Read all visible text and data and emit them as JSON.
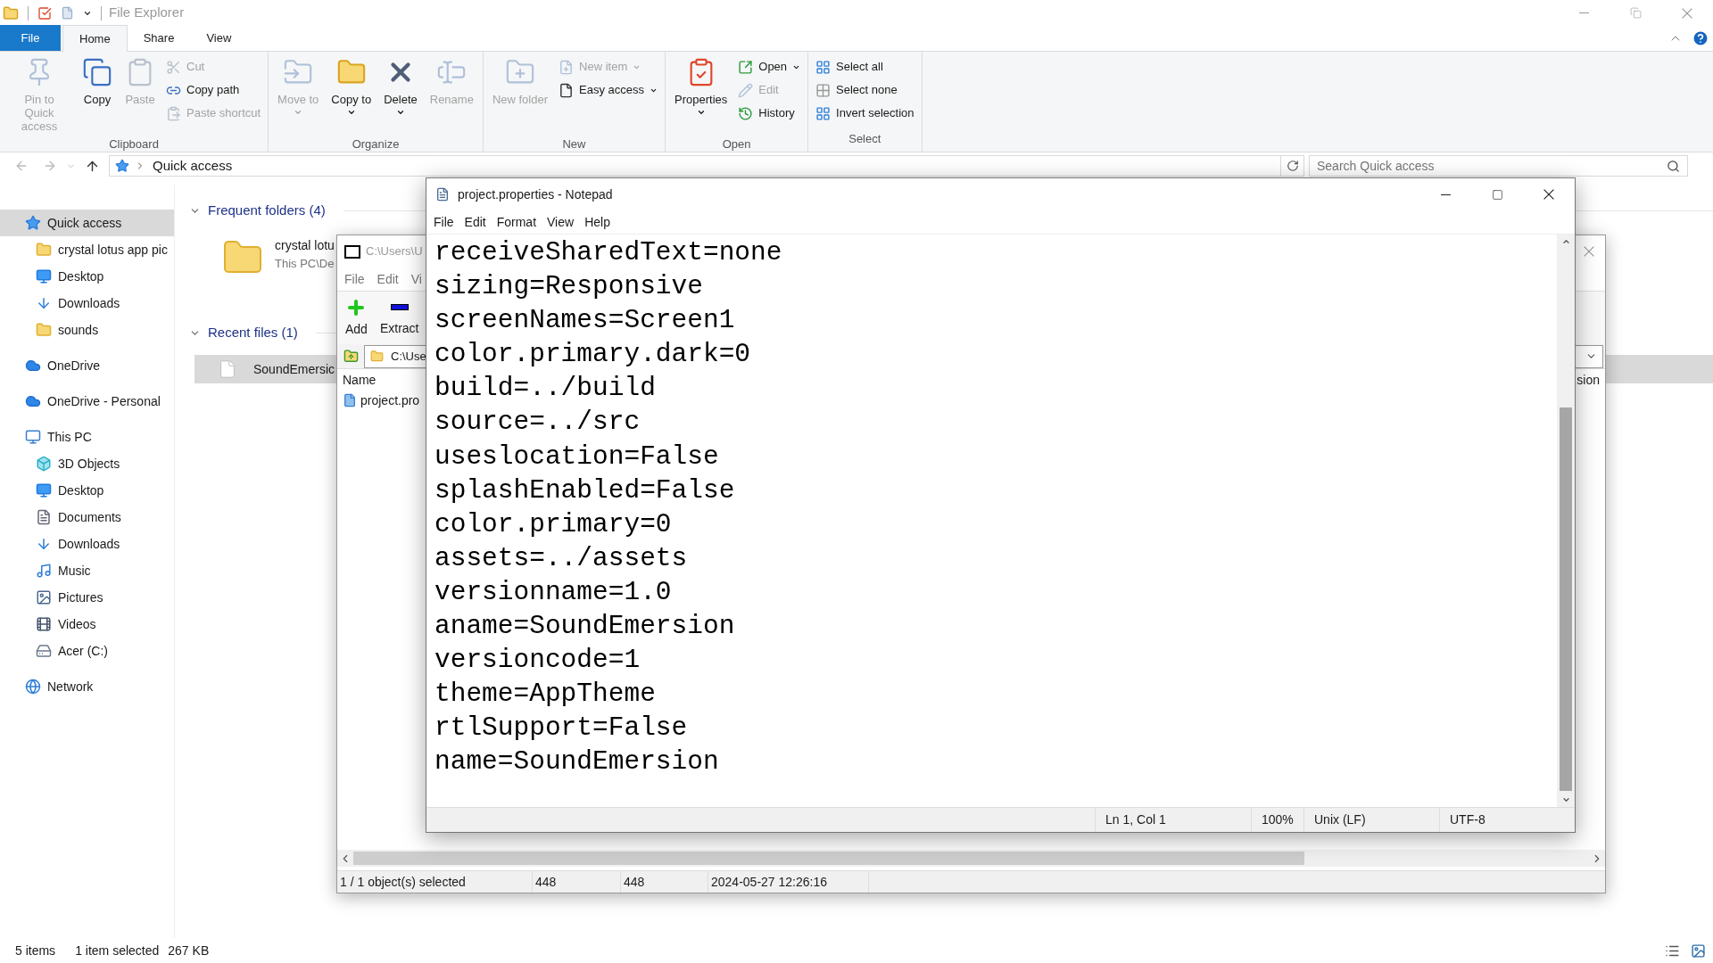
{
  "explorer": {
    "title": "File Explorer",
    "tabs": [
      {
        "label": "File",
        "kind": "menu",
        "selected": false
      },
      {
        "label": "Home",
        "kind": "tab",
        "selected": true
      },
      {
        "label": "Share",
        "kind": "tab",
        "selected": false
      },
      {
        "label": "View",
        "kind": "tab",
        "selected": false
      }
    ],
    "ribbon": [
      {
        "label": "Clipboard",
        "items": [
          {
            "label": "Pin to Quick access",
            "kind": "pin",
            "disabled": true,
            "dropdown": false
          },
          {
            "label": "Copy",
            "kind": "copy",
            "disabled": false,
            "dropdown": false
          },
          {
            "label": "Paste",
            "kind": "paste",
            "disabled": true,
            "dropdown": false
          },
          {
            "label": "Cut",
            "kind": "cut",
            "disabled": true,
            "dropdown": false
          },
          {
            "label": "Copy path",
            "kind": "copy-path",
            "disabled": false,
            "dropdown": false
          },
          {
            "label": "Paste shortcut",
            "kind": "paste-shortcut",
            "disabled": true,
            "dropdown": false
          }
        ]
      },
      {
        "label": "Organize",
        "items": [
          {
            "label": "Move to",
            "kind": "move",
            "disabled": true,
            "dropdown": true
          },
          {
            "label": "Copy to",
            "kind": "copy-to",
            "disabled": false,
            "dropdown": true
          },
          {
            "label": "Delete",
            "kind": "delete",
            "disabled": false,
            "dropdown": true
          },
          {
            "label": "Rename",
            "kind": "rename",
            "disabled": true,
            "dropdown": false
          }
        ]
      },
      {
        "label": "New",
        "items": [
          {
            "label": "New folder",
            "kind": "new-folder",
            "disabled": true,
            "dropdown": false
          },
          {
            "label": "New item",
            "kind": "new-item",
            "disabled": true,
            "dropdown": true
          },
          {
            "label": "Easy access",
            "kind": "easy-access",
            "disabled": false,
            "dropdown": true
          }
        ]
      },
      {
        "label": "Open",
        "items": [
          {
            "label": "Properties",
            "kind": "properties",
            "disabled": false,
            "dropdown": true
          },
          {
            "label": "Open",
            "kind": "open",
            "disabled": false,
            "dropdown": true
          },
          {
            "label": "Edit",
            "kind": "edit",
            "disabled": true,
            "dropdown": false
          },
          {
            "label": "History",
            "kind": "history",
            "disabled": false,
            "dropdown": false
          }
        ]
      },
      {
        "label": "Select",
        "items": [
          {
            "label": "Select all",
            "kind": "select-all",
            "disabled": false,
            "dropdown": false
          },
          {
            "label": "Select none",
            "kind": "select-none",
            "disabled": false,
            "dropdown": false
          },
          {
            "label": "Invert selection",
            "kind": "invert",
            "disabled": false,
            "dropdown": false
          }
        ]
      }
    ],
    "address": {
      "path": "Quick access"
    },
    "search": {
      "placeholder": "Search Quick access"
    },
    "nav": [
      {
        "label": "Quick access",
        "kind": "quick-access",
        "selected": true,
        "children": [
          {
            "label": "crystal lotus app pic",
            "kind": "folder",
            "selected": false
          },
          {
            "label": "Desktop",
            "kind": "desktop",
            "selected": false
          },
          {
            "label": "Downloads",
            "kind": "downloads",
            "selected": false
          },
          {
            "label": "sounds",
            "kind": "folder",
            "selected": false
          }
        ]
      },
      {
        "label": "OneDrive",
        "kind": "cloud",
        "selected": false
      },
      {
        "label": "OneDrive - Personal",
        "kind": "cloud",
        "selected": false
      },
      {
        "label": "This PC",
        "kind": "pc",
        "selected": false,
        "children": [
          {
            "label": "3D Objects",
            "kind": "objects3d",
            "selected": false
          },
          {
            "label": "Desktop",
            "kind": "desktop",
            "selected": false
          },
          {
            "label": "Documents",
            "kind": "documents",
            "selected": false
          },
          {
            "label": "Downloads",
            "kind": "downloads",
            "selected": false
          },
          {
            "label": "Music",
            "kind": "music",
            "selected": false
          },
          {
            "label": "Pictures",
            "kind": "pictures",
            "selected": false
          },
          {
            "label": "Videos",
            "kind": "videos",
            "selected": false
          },
          {
            "label": "Acer (C:)",
            "kind": "drive",
            "selected": false
          }
        ]
      },
      {
        "label": "Network",
        "kind": "network",
        "selected": false
      }
    ],
    "frequent": {
      "heading": "Frequent folders (4)",
      "items": [
        {
          "name": "crystal lotu",
          "location": "This PC\\De"
        }
      ]
    },
    "recent": {
      "heading": "Recent files (1)",
      "items": [
        {
          "name": "SoundEmersic",
          "selected": true
        }
      ]
    },
    "status": [
      "5 items",
      "1 item selected",
      "267 KB"
    ]
  },
  "archive_window": {
    "title": "C:\\Users\\U",
    "menu": [
      "File",
      "Edit",
      "Vi"
    ],
    "toolbar": [
      {
        "label": "Add",
        "kind": "add"
      },
      {
        "label": "Extract",
        "kind": "extract"
      }
    ],
    "path": "C:\\Use",
    "columns": [
      "Name",
      "sion"
    ],
    "files": [
      {
        "name": "project.pro"
      }
    ],
    "status": [
      "1 / 1 object(s) selected",
      "448",
      "448",
      "2024-05-27 12:26:16"
    ]
  },
  "notepad": {
    "title": "project.properties - Notepad",
    "menu": [
      "File",
      "Edit",
      "Format",
      "View",
      "Help"
    ],
    "lines": [
      "receiveSharedText=none",
      "sizing=Responsive",
      "screenNames=Screen1",
      "color.primary.dark=0",
      "build=../build",
      "source=../src",
      "useslocation=False",
      "splashEnabled=False",
      "color.primary=0",
      "assets=../assets",
      "versionname=1.0",
      "aname=SoundEmersion",
      "versioncode=1",
      "theme=AppTheme",
      "rtlSupport=False",
      "name=SoundEmersion"
    ],
    "status": [
      "Ln 1, Col 1",
      "100%",
      "Unix (LF)",
      "UTF-8"
    ]
  }
}
